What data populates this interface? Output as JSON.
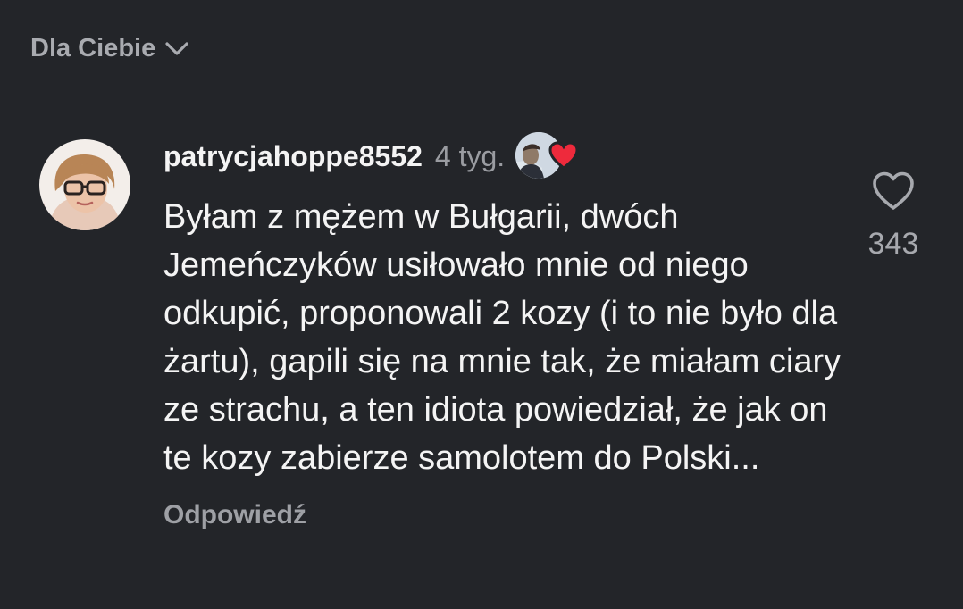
{
  "header": {
    "label": "Dla Ciebie",
    "chevron_icon": "chevron-down-icon"
  },
  "comment": {
    "avatar_icon": "user-avatar",
    "username": "patrycjahoppe8552",
    "time": "4 tyg.",
    "author_liked_icon": "author-liked-heart-icon",
    "text": "Byłam z mężem w Bułgarii, dwóch Jemeńczyków usiłowało mnie od niego odkupić, proponowali 2 kozy (i to nie było dla żartu), gapili się na mnie tak, że miałam ciary ze strachu, a ten idiota powiedział, że jak on te kozy zabierze samolotem do Polski...",
    "reply_label": "Odpowiedź",
    "like_icon": "heart-outline-icon",
    "like_count": "343"
  },
  "colors": {
    "background": "#232529",
    "text_primary": "#f4f4f4",
    "text_secondary": "#9ea0a5",
    "heart_red": "#ee2a3c"
  }
}
